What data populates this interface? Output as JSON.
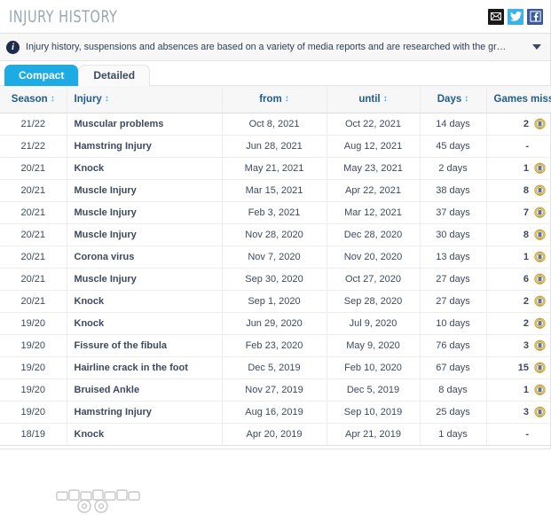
{
  "header": {
    "title": "INJURY HISTORY",
    "share": [
      {
        "name": "mail",
        "label": "Share by email",
        "color": "#1a1a1a"
      },
      {
        "name": "twitter",
        "label": "Share on Twitter",
        "color": "#3bb2e8"
      },
      {
        "name": "facebook",
        "label": "Share on Facebook",
        "color": "#3b5998"
      }
    ]
  },
  "info": {
    "icon": "info-icon",
    "text": "Injury history, suspensions and absences are based on a variety of media reports and are researched with the greatest of care. If...",
    "caret": "chevron-down-icon"
  },
  "tabs": [
    {
      "label": "Compact",
      "active": true
    },
    {
      "label": "Detailed",
      "active": false
    }
  ],
  "table": {
    "sort_icon": "↕",
    "columns": [
      {
        "key": "season",
        "label": "Season",
        "sortable": true
      },
      {
        "key": "injury",
        "label": "Injury",
        "sortable": true
      },
      {
        "key": "from",
        "label": "from",
        "sortable": true
      },
      {
        "key": "until",
        "label": "until",
        "sortable": true
      },
      {
        "key": "days",
        "label": "Days",
        "sortable": true
      },
      {
        "key": "games_missed",
        "label": "Games missed",
        "sortable": true
      }
    ],
    "rows": [
      {
        "season": "21/22",
        "injury": "Muscular problems",
        "from": "Oct 8, 2021",
        "until": "Oct 22, 2021",
        "days": "14 days",
        "games_missed": "2",
        "club_crest": true
      },
      {
        "season": "21/22",
        "injury": "Hamstring Injury",
        "from": "Jun 28, 2021",
        "until": "Aug 12, 2021",
        "days": "45 days",
        "games_missed": "-",
        "club_crest": false
      },
      {
        "season": "20/21",
        "injury": "Knock",
        "from": "May 21, 2021",
        "until": "May 23, 2021",
        "days": "2 days",
        "games_missed": "1",
        "club_crest": true
      },
      {
        "season": "20/21",
        "injury": "Muscle Injury",
        "from": "Mar 15, 2021",
        "until": "Apr 22, 2021",
        "days": "38 days",
        "games_missed": "8",
        "club_crest": true
      },
      {
        "season": "20/21",
        "injury": "Muscle Injury",
        "from": "Feb 3, 2021",
        "until": "Mar 12, 2021",
        "days": "37 days",
        "games_missed": "7",
        "club_crest": true
      },
      {
        "season": "20/21",
        "injury": "Muscle Injury",
        "from": "Nov 28, 2020",
        "until": "Dec 28, 2020",
        "days": "30 days",
        "games_missed": "8",
        "club_crest": true
      },
      {
        "season": "20/21",
        "injury": "Corona virus",
        "from": "Nov 7, 2020",
        "until": "Nov 20, 2020",
        "days": "13 days",
        "games_missed": "1",
        "club_crest": true
      },
      {
        "season": "20/21",
        "injury": "Muscle Injury",
        "from": "Sep 30, 2020",
        "until": "Oct 27, 2020",
        "days": "27 days",
        "games_missed": "6",
        "club_crest": true
      },
      {
        "season": "20/21",
        "injury": "Knock",
        "from": "Sep 1, 2020",
        "until": "Sep 28, 2020",
        "days": "27 days",
        "games_missed": "2",
        "club_crest": true
      },
      {
        "season": "19/20",
        "injury": "Knock",
        "from": "Jun 29, 2020",
        "until": "Jul 9, 2020",
        "days": "10 days",
        "games_missed": "2",
        "club_crest": true
      },
      {
        "season": "19/20",
        "injury": "Fissure of the fibula",
        "from": "Feb 23, 2020",
        "until": "May 9, 2020",
        "days": "76 days",
        "games_missed": "3",
        "club_crest": true
      },
      {
        "season": "19/20",
        "injury": "Hairline crack in the foot",
        "from": "Dec 5, 2019",
        "until": "Feb 10, 2020",
        "days": "67 days",
        "games_missed": "15",
        "club_crest": true
      },
      {
        "season": "19/20",
        "injury": "Bruised Ankle",
        "from": "Nov 27, 2019",
        "until": "Dec 5, 2019",
        "days": "8 days",
        "games_missed": "1",
        "club_crest": true
      },
      {
        "season": "19/20",
        "injury": "Hamstring Injury",
        "from": "Aug 16, 2019",
        "until": "Sep 10, 2019",
        "days": "25 days",
        "games_missed": "3",
        "club_crest": true
      },
      {
        "season": "18/19",
        "injury": "Knock",
        "from": "Apr 20, 2019",
        "until": "Apr 21, 2019",
        "days": "1 days",
        "games_missed": "-",
        "club_crest": false
      }
    ]
  },
  "watermark": {
    "name": "site-watermark"
  },
  "colors": {
    "accent": "#1cabe2",
    "header_title": "#99a7b5",
    "column_header_text": "#1f5c8b",
    "body_text": "#3c4a5e",
    "info_bg": "#f7f7f7"
  }
}
